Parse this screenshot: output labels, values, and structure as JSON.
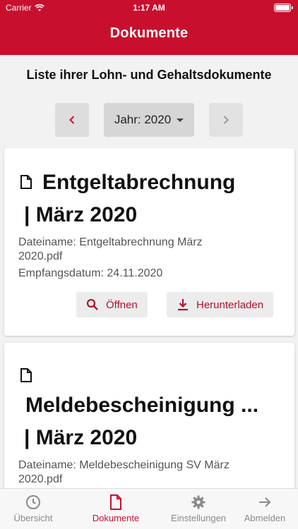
{
  "status": {
    "carrier": "Carrier",
    "time": "1:17 AM"
  },
  "header": {
    "title": "Dokumente"
  },
  "subtitle": "Liste ihrer Lohn- und Gehaltsdokumente",
  "year_selector": {
    "label": "Jahr: 2020"
  },
  "documents": [
    {
      "title_line1": "Entgeltabrechnung",
      "title_line2": "| März 2020",
      "filename_line1": "Dateiname: Entgeltabrechnung März",
      "filename_line2": "2020.pdf",
      "received": "Empfangsdatum: 24.11.2020",
      "open_label": "Öffnen",
      "download_label": "Herunterladen"
    },
    {
      "title_line1": "Meldebescheinigung ...",
      "title_line2": "| März 2020",
      "filename_line1": "Dateiname: Meldebescheinigung SV März",
      "filename_line2": "2020.pdf"
    }
  ],
  "tabs": [
    {
      "label": "Übersicht",
      "icon": "clock-icon"
    },
    {
      "label": "Dokumente",
      "icon": "document-icon"
    },
    {
      "label": "Einstellungen",
      "icon": "gear-icon"
    },
    {
      "label": "Abmelden",
      "icon": "arrow-right-icon"
    }
  ],
  "colors": {
    "accent": "#c8102e",
    "background": "#f2f2f2"
  }
}
